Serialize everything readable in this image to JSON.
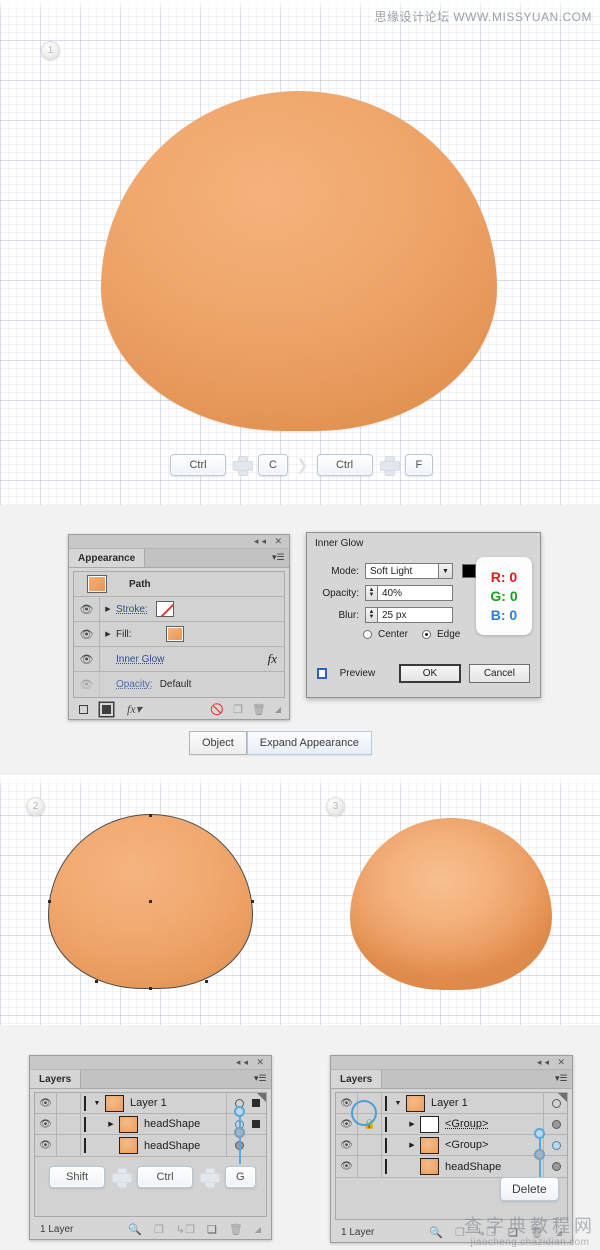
{
  "watermarks": {
    "top": "思缘设计论坛 WWW.MISSYUAN.COM",
    "bottom_cn": "查字典教程网",
    "bottom_url": "jiaocheng.chazidian.com"
  },
  "steps": {
    "one": "1",
    "two": "2",
    "three": "3"
  },
  "shortcuts": {
    "copy": "Ctrl",
    "copy_key": "C",
    "paste_front": "Ctrl",
    "paste_key": "F",
    "arrow": "❯"
  },
  "object_row": {
    "object": "Object",
    "expand_appearance": "Expand Appearance"
  },
  "appearance": {
    "tab": "Appearance",
    "rows": [
      {
        "label": "Path",
        "type": "header"
      },
      {
        "label": "Stroke:",
        "type": "stroke"
      },
      {
        "label": "Fill:",
        "type": "fill"
      },
      {
        "label": "Inner Glow",
        "type": "effect",
        "fx": "fx"
      },
      {
        "label": "Opacity:",
        "value": "Default",
        "type": "opacity"
      }
    ],
    "footer_icons": [
      "new-stroke",
      "new-fill",
      "fx",
      "clear-appearance",
      "duplicate",
      "delete"
    ]
  },
  "inner_glow": {
    "title": "Inner Glow",
    "mode_label": "Mode:",
    "mode_value": "Soft Light",
    "color": "#000000",
    "opacity_label": "Opacity:",
    "opacity_value": "40%",
    "blur_label": "Blur:",
    "blur_value": "25 px",
    "center_label": "Center",
    "edge_label": "Edge",
    "selected_radio": "Edge",
    "preview_label": "Preview",
    "ok": "OK",
    "cancel": "Cancel",
    "rgb": {
      "r": "R: 0",
      "g": "G: 0",
      "b": "B: 0"
    }
  },
  "layers_left": {
    "tab": "Layers",
    "rows": [
      {
        "name": "Layer 1",
        "thumb": "orange",
        "expanded": true,
        "indent": 0
      },
      {
        "name": "headShape",
        "thumb": "orange",
        "expanded": false,
        "indent": 1
      },
      {
        "name": "headShape",
        "thumb": "orange",
        "expanded": null,
        "indent": 1
      }
    ],
    "shortcut": {
      "k1": "Shift",
      "k2": "Ctrl",
      "k3": "G"
    },
    "footer": "1 Layer"
  },
  "layers_right": {
    "tab": "Layers",
    "rows": [
      {
        "name": "Layer 1",
        "thumb": "orange",
        "expanded": true,
        "indent": 0
      },
      {
        "name": "<Group>",
        "thumb": "white",
        "expanded": false,
        "indent": 1,
        "locked": true
      },
      {
        "name": "<Group>",
        "thumb": "orange",
        "expanded": false,
        "indent": 1
      },
      {
        "name": "headShape",
        "thumb": "orange",
        "expanded": null,
        "indent": 1
      }
    ],
    "delete_button": "Delete",
    "footer": "1 Layer"
  },
  "colors": {
    "egg_light": "#F4B27B",
    "egg_mid": "#F0A76C",
    "egg_dark": "#E0914F",
    "panel_bg": "#D6D6D6",
    "accent_blue": "#4D9FD6"
  }
}
